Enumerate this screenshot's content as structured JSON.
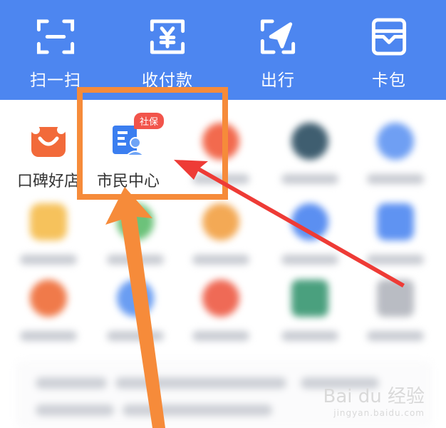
{
  "top_bar": {
    "items": [
      {
        "label": "扫一扫",
        "icon": "scan-icon"
      },
      {
        "label": "收付款",
        "icon": "payment-icon"
      },
      {
        "label": "出行",
        "icon": "travel-icon"
      },
      {
        "label": "卡包",
        "icon": "card-wallet-icon"
      }
    ]
  },
  "apps": {
    "koubei": {
      "label": "口碑好店",
      "icon": "koubei-smile-icon"
    },
    "citizen_center": {
      "label": "市民中心",
      "badge": "社保",
      "icon": "citizen-center-icon"
    }
  },
  "watermark": {
    "main": "Bai du 经验",
    "sub": "jingyan.baidu.com"
  },
  "colors": {
    "brand_blue": "#4d86f0",
    "highlight_orange": "#f68b3a",
    "arrow_red": "#ee3b36"
  }
}
